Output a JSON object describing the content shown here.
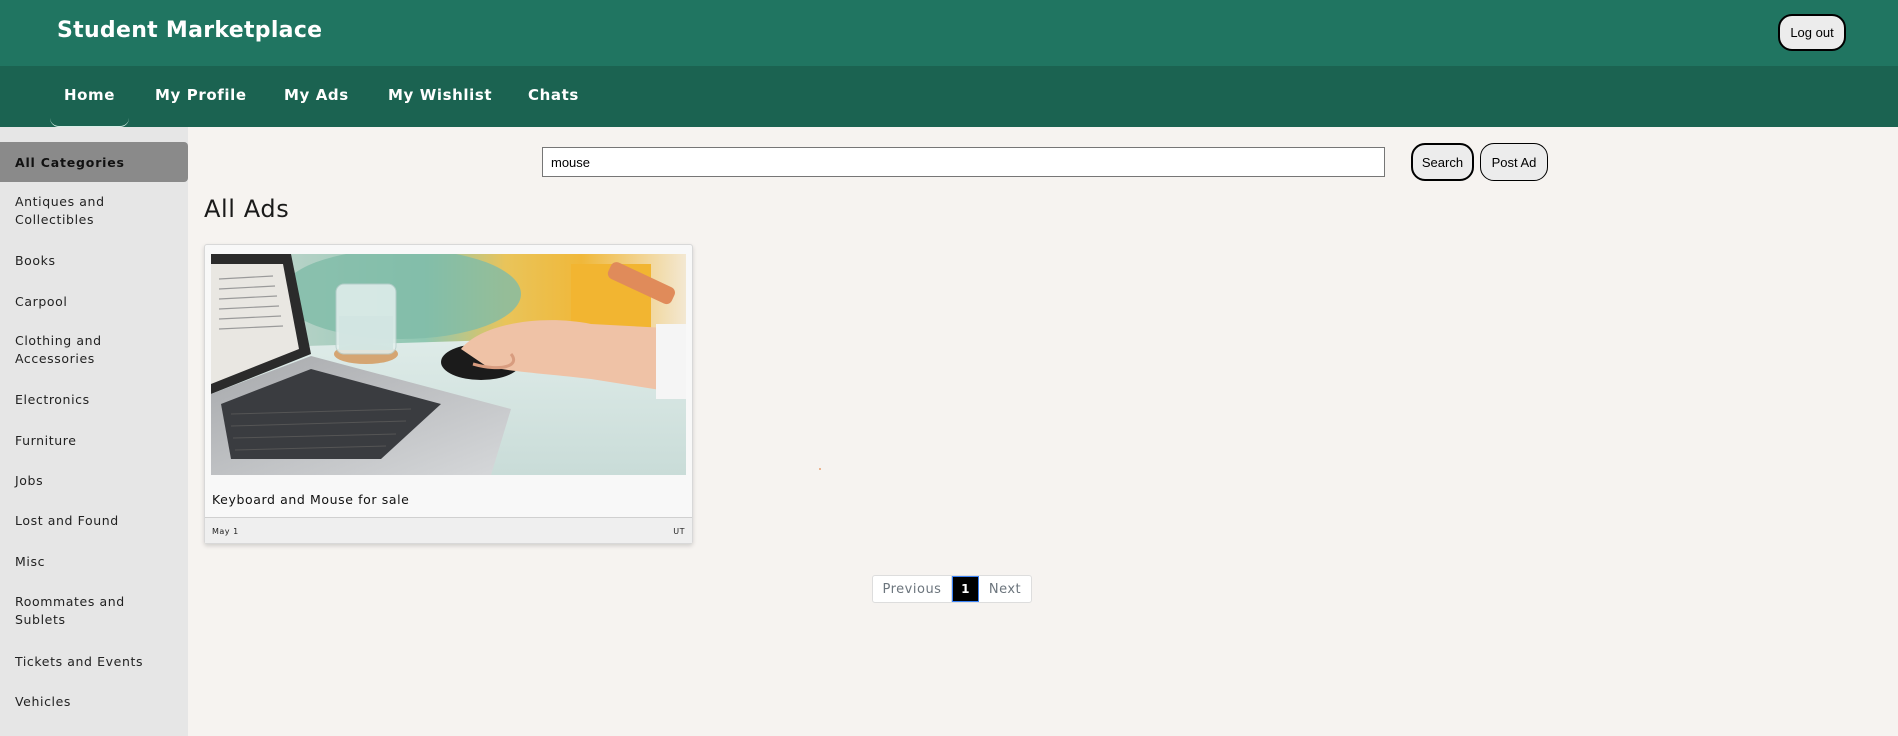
{
  "header": {
    "brand": "Student Marketplace",
    "logout_label": "Log out"
  },
  "nav": {
    "items": [
      {
        "label": "Home",
        "active": true
      },
      {
        "label": "My Profile"
      },
      {
        "label": "My Ads"
      },
      {
        "label": "My Wishlist"
      },
      {
        "label": "Chats"
      }
    ]
  },
  "sidebar": {
    "all_label": "All Categories",
    "categories": [
      "Antiques and Collectibles",
      "Books",
      "Carpool",
      "Clothing and Accessories",
      "Electronics",
      "Furniture",
      "Jobs",
      "Lost and Found",
      "Misc",
      "Roommates and Sublets",
      "Tickets and Events",
      "Vehicles"
    ]
  },
  "search": {
    "value": "mouse",
    "button_label": "Search",
    "post_label": "Post Ad"
  },
  "main": {
    "heading": "All Ads"
  },
  "ads": [
    {
      "title": "Keyboard and Mouse for sale",
      "date": "May 1",
      "location": "UT",
      "image": "laptop-and-mouse-photo"
    }
  ],
  "pagination": {
    "previous_label": "Previous",
    "current_page": "1",
    "next_label": "Next"
  },
  "colors": {
    "topbar": "#207561",
    "navbar": "#1b6351",
    "sidebar": "#e6e6e6",
    "active_category": "#8a8a8a",
    "page_background": "#f6f3f0"
  }
}
